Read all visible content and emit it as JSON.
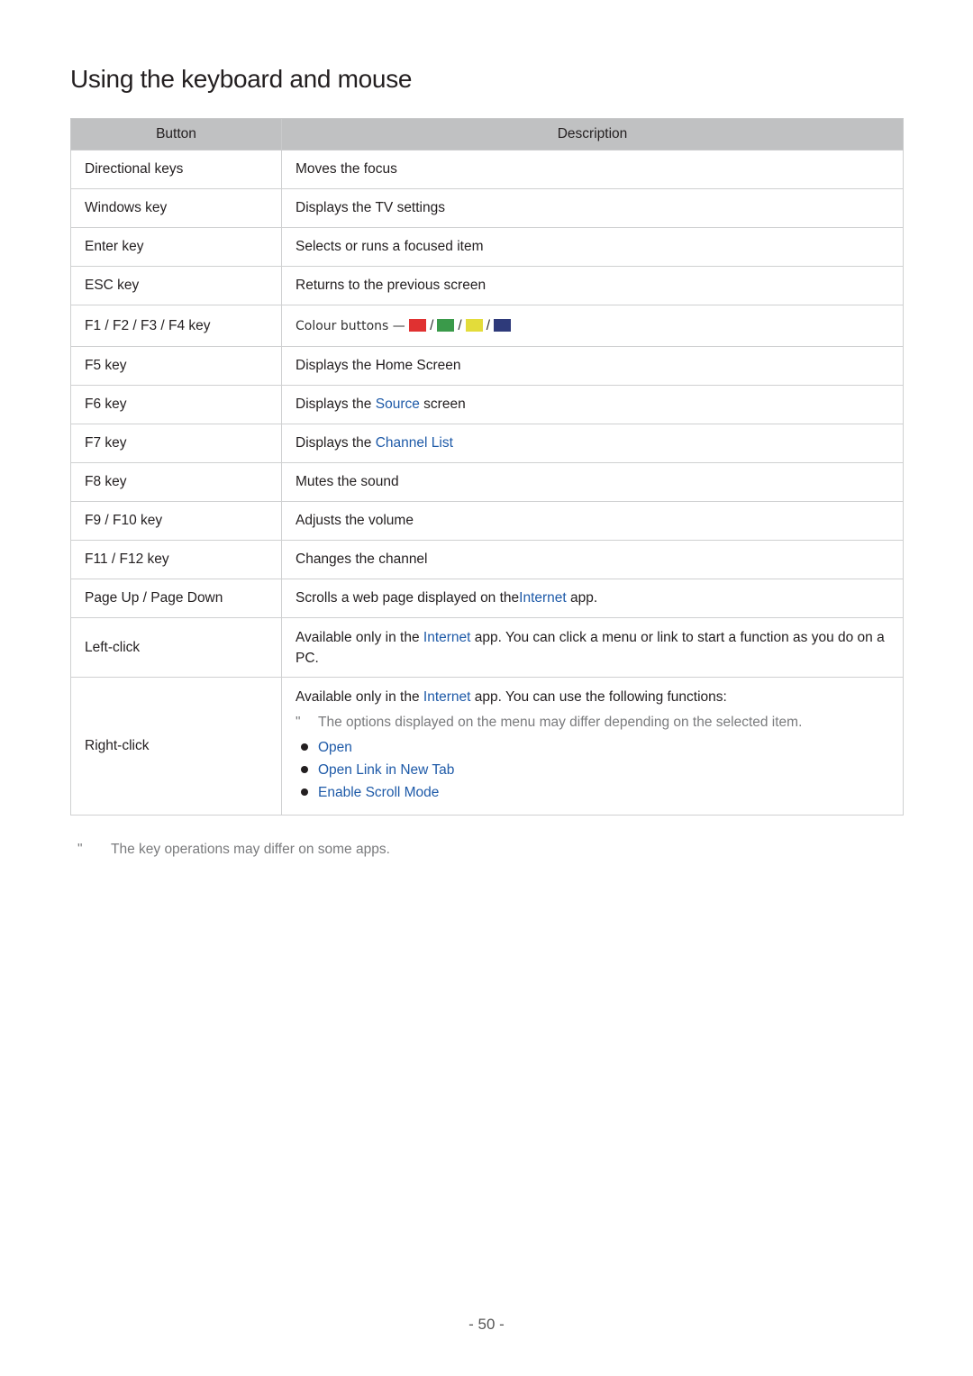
{
  "title": "Using the keyboard and mouse",
  "table": {
    "headers": [
      "Button",
      "Description"
    ],
    "rows": [
      {
        "button": "Directional keys",
        "desc": "Moves the focus"
      },
      {
        "button": "Windows key",
        "desc": "Displays the TV settings"
      },
      {
        "button": "Enter key",
        "desc": "Selects or runs a focused item"
      },
      {
        "button": "ESC key",
        "desc": "Returns to the previous screen"
      },
      {
        "button": "F1 / F2 / F3 / F4 key",
        "desc": "Colour buttons —",
        "colours": [
          "#e03131",
          "#3a9a4a",
          "#e3dc3a",
          "#2e3a7a"
        ],
        "sep": "/"
      },
      {
        "button": "F5 key",
        "desc": "Displays the Home Screen"
      },
      {
        "button": "F6 key",
        "desc_pre": "Displays the ",
        "desc_link": "Source",
        "desc_post": " screen"
      },
      {
        "button": "F7 key",
        "desc_pre": "Displays the ",
        "desc_link": "Channel List"
      },
      {
        "button": "F8 key",
        "desc": "Mutes the sound"
      },
      {
        "button": "F9 / F10 key",
        "desc": "Adjusts the volume"
      },
      {
        "button": "F11 / F12 key",
        "desc": "Changes the channel"
      },
      {
        "button": "Page Up / Page Down",
        "desc_pre": "Scrolls a web page displayed on the",
        "desc_link": "Internet",
        "desc_post": " app."
      },
      {
        "button": "Left-click",
        "desc_pre": "Available only in the ",
        "desc_link": "Internet",
        "desc_post": " app. You can click a menu or link to start a function as you do on a PC."
      },
      {
        "button": "Right-click",
        "desc_pre": "Available only in the ",
        "desc_link": "Internet",
        "desc_post": " app. You can use the following functions:",
        "note_mark": "\"",
        "note": "The options displayed on the menu may differ depending on the selected item.",
        "functions": [
          "Open",
          "Open Link in New Tab",
          "Enable Scroll Mode"
        ]
      }
    ]
  },
  "footnote": {
    "mark": "\"",
    "text": "The key operations may differ on some apps."
  },
  "page_number": "- 50 -"
}
